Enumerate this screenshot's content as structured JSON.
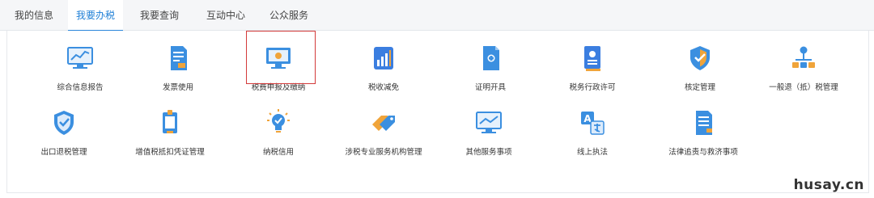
{
  "tabs": [
    {
      "label": "我的信息",
      "active": false
    },
    {
      "label": "我要办税",
      "active": true
    },
    {
      "label": "我要查询",
      "active": false
    },
    {
      "label": "互动中心",
      "active": false
    },
    {
      "label": "公众服务",
      "active": false
    }
  ],
  "row1": [
    {
      "label": "综合信息报告",
      "icon": "monitor-chart-icon"
    },
    {
      "label": "发票使用",
      "icon": "invoice-document-icon"
    },
    {
      "label": "税费申报及缴纳",
      "icon": "monitor-declare-icon",
      "highlighted": true
    },
    {
      "label": "税收减免",
      "icon": "bar-chart-tile-icon"
    },
    {
      "label": "证明开具",
      "icon": "certificate-document-icon"
    },
    {
      "label": "税务行政许可",
      "icon": "license-document-icon"
    },
    {
      "label": "核定管理",
      "icon": "shield-check-icon"
    },
    {
      "label": "一般退（抵）税管理",
      "icon": "hierarchy-icon"
    }
  ],
  "row2": [
    {
      "label": "出口退税管理",
      "icon": "export-shield-icon"
    },
    {
      "label": "增值税抵扣凭证管理",
      "icon": "deduction-voucher-icon"
    },
    {
      "label": "纳税信用",
      "icon": "lightbulb-badge-icon"
    },
    {
      "label": "涉税专业服务机构管理",
      "icon": "tag-pair-icon"
    },
    {
      "label": "其他服务事项",
      "icon": "monitor-line-icon"
    },
    {
      "label": "线上执法",
      "icon": "translate-icon"
    },
    {
      "label": "法律追责与救济事项",
      "icon": "legal-document-icon"
    }
  ],
  "colors": {
    "accent": "#2a86db",
    "highlight_border": "#d33a3a",
    "icon_blue": "#3b8fe0",
    "icon_orange": "#f0a43a"
  },
  "watermark": "husay.cn"
}
